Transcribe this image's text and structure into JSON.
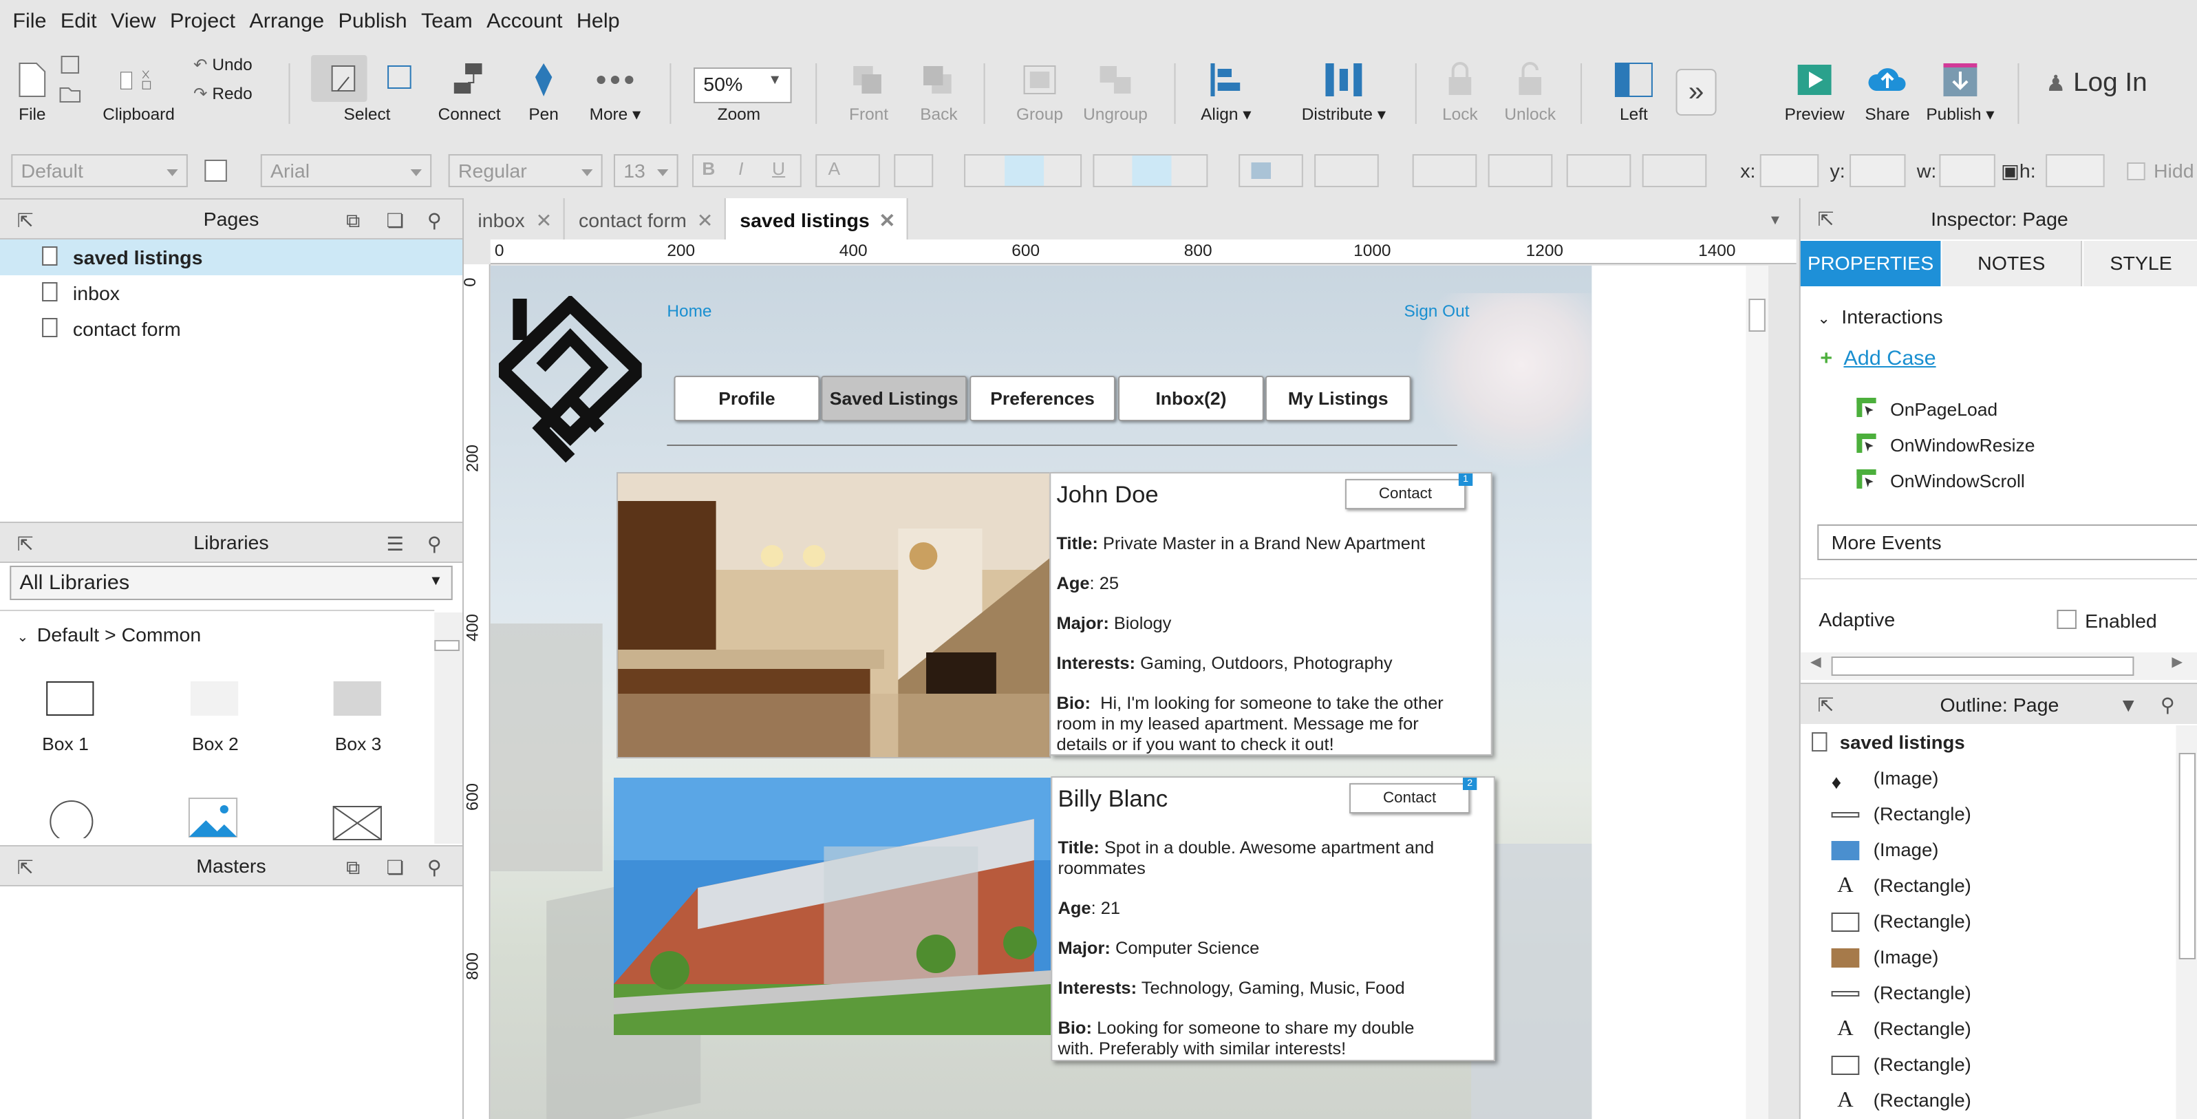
{
  "menu": [
    "File",
    "Edit",
    "View",
    "Project",
    "Arrange",
    "Publish",
    "Team",
    "Account",
    "Help"
  ],
  "toolbar": {
    "file": "File",
    "clipboard": "Clipboard",
    "undo": "Undo",
    "redo": "Redo",
    "select": "Select",
    "connect": "Connect",
    "pen": "Pen",
    "more": "More ▾",
    "zoom_value": "50%",
    "zoom": "Zoom",
    "front": "Front",
    "back": "Back",
    "group": "Group",
    "ungroup": "Ungroup",
    "align": "Align ▾",
    "distribute": "Distribute ▾",
    "lock": "Lock",
    "unlock": "Unlock",
    "left": "Left",
    "preview": "Preview",
    "share": "Share",
    "publish": "Publish ▾",
    "login": "Log In"
  },
  "formatbar": {
    "style": "Default",
    "font": "Arial",
    "weight": "Regular",
    "size": "13",
    "x": "x:",
    "y": "y:",
    "w": "w:",
    "h": "h:",
    "hidden": "Hidd"
  },
  "pages_panel": {
    "title": "Pages",
    "items": [
      "saved listings",
      "inbox",
      "contact form"
    ]
  },
  "libraries_panel": {
    "title": "Libraries",
    "dropdown": "All Libraries",
    "group": "Default > Common",
    "widgets": [
      "Box 1",
      "Box 2",
      "Box 3"
    ]
  },
  "masters_panel": {
    "title": "Masters"
  },
  "tabs": [
    "inbox",
    "contact form",
    "saved listings"
  ],
  "ruler": {
    "h": [
      "0",
      "200",
      "400",
      "600",
      "800",
      "1000",
      "1200",
      "1400"
    ],
    "v": [
      "0",
      "200",
      "400",
      "600",
      "800"
    ]
  },
  "design": {
    "home": "Home",
    "signout": "Sign Out",
    "nav": [
      "Profile",
      "Saved Listings",
      "Preferences",
      "Inbox(2)",
      "My Listings"
    ],
    "cards": [
      {
        "name": "John Doe",
        "contact": "Contact",
        "badge": "1",
        "title_label": "Title:",
        "title": "Private Master in a Brand New Apartment",
        "age_label": "Age",
        "age": ": 25",
        "major_label": "Major:",
        "major": "Biology",
        "interests_label": "Interests:",
        "interests": "Gaming, Outdoors, Photography",
        "bio_label": "Bio:",
        "bio": "Hi, I'm looking for someone to take the other room in my leased apartment. Message me for details or if you want to check it out!"
      },
      {
        "name": "Billy Blanc",
        "contact": "Contact",
        "badge": "2",
        "title_label": "Title:",
        "title": "Spot in a double. Awesome apartment and roommates",
        "age_label": "Age",
        "age": ": 21",
        "major_label": "Major:",
        "major": "Computer Science",
        "interests_label": "Interests:",
        "interests": "Technology, Gaming, Music, Food",
        "bio_label": "Bio:",
        "bio": "Looking for someone to share my double with. Preferably with similar interests!"
      }
    ]
  },
  "inspector": {
    "title": "Inspector: Page",
    "tabs": [
      "PROPERTIES",
      "NOTES",
      "STYLE"
    ],
    "interactions": "Interactions",
    "add_case": "Add Case",
    "events": [
      "OnPageLoad",
      "OnWindowResize",
      "OnWindowScroll"
    ],
    "more_events": "More Events",
    "adaptive": "Adaptive",
    "enabled": "Enabled"
  },
  "outline": {
    "title": "Outline: Page",
    "root": "saved listings",
    "items": [
      "(Image)",
      "(Rectangle)",
      "(Image)",
      "(Rectangle)",
      "(Rectangle)",
      "(Image)",
      "(Rectangle)",
      "(Rectangle)",
      "(Rectangle)",
      "(Rectangle)"
    ]
  },
  "colors": {
    "accent": "#1e90d8",
    "link": "#1a8fd0",
    "selected_page": "#cde8f6",
    "green": "#4caf3c"
  }
}
